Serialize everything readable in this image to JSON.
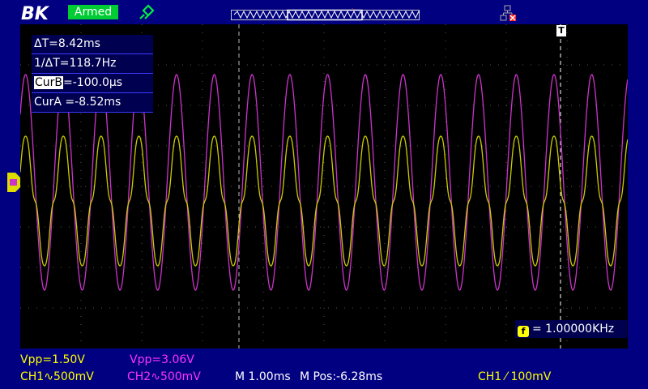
{
  "header": {
    "logo_text": "BK",
    "status": "Armed",
    "icons": [
      "probe-icon",
      "trigger-position-bar",
      "network-icon"
    ]
  },
  "cursor_measure": {
    "delta_t": "ΔT=8.42ms",
    "inv_delta_t": "1/ΔT=118.7Hz",
    "cur_b_label": "CurB",
    "cur_b_value": "=-100.0μs",
    "cur_a": "CurA =-8.52ms"
  },
  "trigger_marker": "T",
  "frequency": "= 1.00000KHz",
  "frequency_icon": "f",
  "footer": {
    "ch1_vpp": "Vpp=1.50V",
    "ch2_vpp": "Vpp=3.06V",
    "ch1_scale": "CH1∿500mV",
    "ch2_scale": "CH2∿500mV",
    "timebase": "M 1.00ms",
    "mpos": "M Pos:-6.28ms",
    "trigger": "CH1 ⁄ 100mV"
  },
  "colors": {
    "ch1": "#cccc00",
    "ch2": "#cc33cc",
    "background": "#000080",
    "screen": "#000000",
    "status": "#00cc33"
  },
  "traces": {
    "ch1": {
      "frequency_hz": 1000,
      "vpp_V": 1.5
    },
    "ch2": {
      "frequency_hz": 1000,
      "vpp_V": 3.06
    }
  }
}
